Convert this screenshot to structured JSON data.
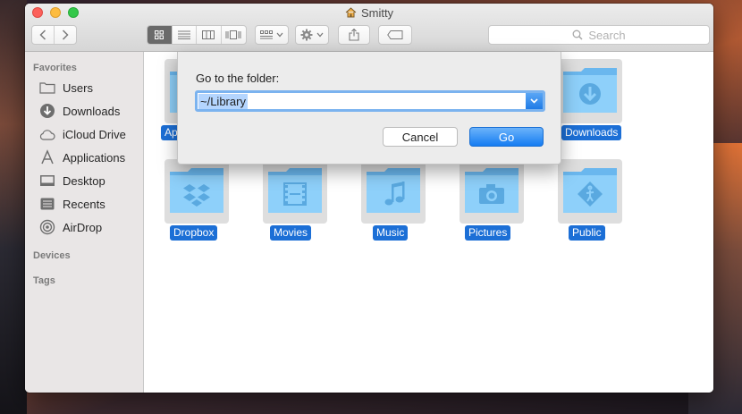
{
  "window": {
    "title": "Smitty"
  },
  "toolbar": {
    "view_modes": [
      "icon-view",
      "list-view",
      "column-view",
      "cover-flow-view"
    ],
    "active_view": "icon-view",
    "search_placeholder": "Search"
  },
  "sidebar": {
    "sections": {
      "favorites": "Favorites",
      "devices": "Devices",
      "tags": "Tags"
    },
    "items": [
      {
        "label": "Users",
        "icon": "folder-icon"
      },
      {
        "label": "Downloads",
        "icon": "download-icon"
      },
      {
        "label": "iCloud Drive",
        "icon": "cloud-icon"
      },
      {
        "label": "Applications",
        "icon": "applications-icon"
      },
      {
        "label": "Desktop",
        "icon": "desktop-icon"
      },
      {
        "label": "Recents",
        "icon": "recents-icon"
      },
      {
        "label": "AirDrop",
        "icon": "airdrop-icon"
      }
    ]
  },
  "folders": [
    {
      "label": "Ap",
      "icon": "applications-folder-icon"
    },
    {
      "label": "Downloads",
      "icon": "downloads-folder-icon"
    },
    {
      "label": "Dropbox",
      "icon": "dropbox-folder-icon"
    },
    {
      "label": "Movies",
      "icon": "movies-folder-icon"
    },
    {
      "label": "Music",
      "icon": "music-folder-icon"
    },
    {
      "label": "Pictures",
      "icon": "pictures-folder-icon"
    },
    {
      "label": "Public",
      "icon": "public-folder-icon"
    }
  ],
  "dialog": {
    "label": "Go to the folder:",
    "input_value": "~/Library",
    "cancel_label": "Cancel",
    "go_label": "Go"
  },
  "colors": {
    "accent": "#1c6fd6",
    "folder": "#72c0f4",
    "sidebar_bg": "#e9e6e6"
  }
}
